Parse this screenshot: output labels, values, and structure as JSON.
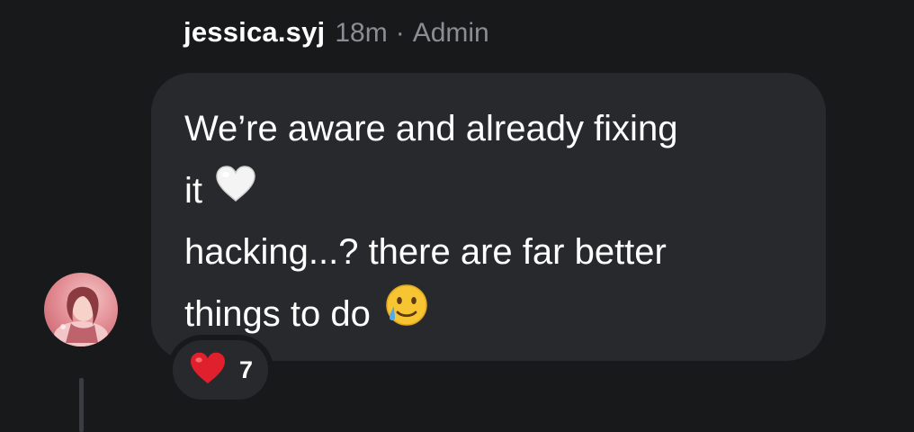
{
  "comment": {
    "username": "jessica.syj",
    "time": "18m",
    "separator": "·",
    "role": "Admin",
    "message_lines": [
      "We’re aware and already fixing",
      "it",
      "hacking...? there are far better",
      "things to do"
    ],
    "emojis": [
      "white-heart-icon",
      "crying-smile-icon"
    ],
    "reaction": {
      "icon": "red-heart-icon",
      "count": "7"
    }
  },
  "colors": {
    "background": "#18191b",
    "bubble": "#27292d",
    "meta_text": "#8a8d93",
    "heart_red": "#e0202c"
  }
}
